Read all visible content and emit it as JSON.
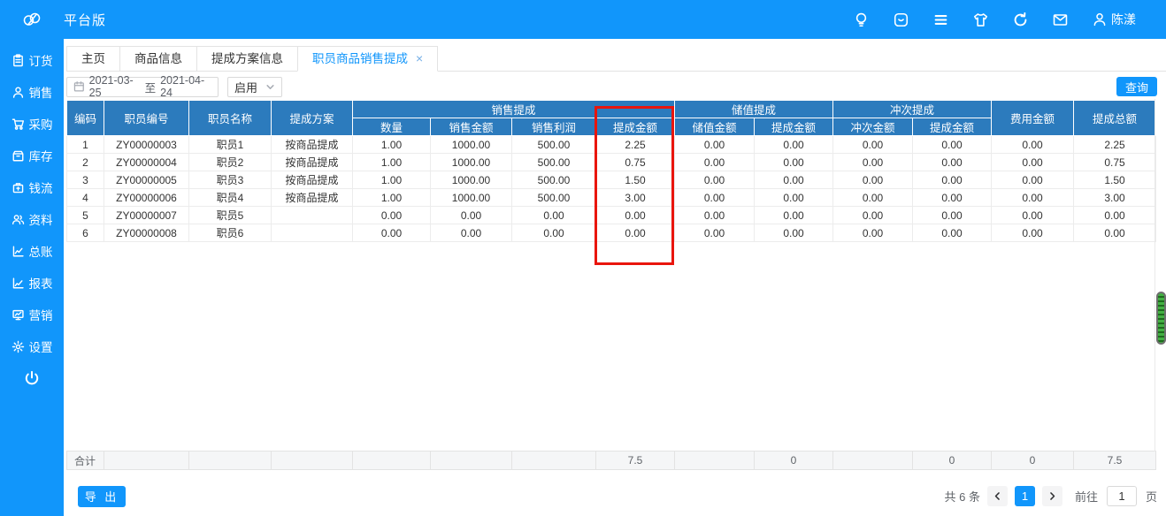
{
  "topbar": {
    "brand": "平台版",
    "user_name": "陈漾"
  },
  "sidebar": {
    "items": [
      {
        "icon": "order-icon",
        "label": "订货"
      },
      {
        "icon": "sales-icon",
        "label": "销售"
      },
      {
        "icon": "purchase-icon",
        "label": "采购"
      },
      {
        "icon": "inventory-icon",
        "label": "库存"
      },
      {
        "icon": "cashflow-icon",
        "label": "钱流"
      },
      {
        "icon": "data-icon",
        "label": "资料"
      },
      {
        "icon": "ledger-icon",
        "label": "总账"
      },
      {
        "icon": "report-icon",
        "label": "报表"
      },
      {
        "icon": "marketing-icon",
        "label": "营销"
      },
      {
        "icon": "settings-icon",
        "label": "设置"
      }
    ]
  },
  "tabs": [
    {
      "label": "主页"
    },
    {
      "label": "商品信息"
    },
    {
      "label": "提成方案信息"
    },
    {
      "label": "职员商品销售提成",
      "close": "×",
      "active": true
    }
  ],
  "filters": {
    "date_start": "2021-03-25",
    "date_separator": "至",
    "date_end": "2021-04-24",
    "status": "启用",
    "query_label": "查询"
  },
  "table": {
    "header": {
      "fixed_left": [
        "编码",
        "职员编号",
        "职员名称",
        "提成方案"
      ],
      "groups": [
        {
          "label": "销售提成",
          "children": [
            "数量",
            "销售金额",
            "销售利润",
            "提成金额"
          ]
        },
        {
          "label": "储值提成",
          "children": [
            "储值金额",
            "提成金额"
          ]
        },
        {
          "label": "冲次提成",
          "children": [
            "冲次金额",
            "提成金额"
          ]
        }
      ],
      "fixed_right": [
        "费用金额",
        "提成总额"
      ]
    },
    "rows": [
      [
        "1",
        "ZY00000003",
        "职员1",
        "按商品提成",
        "1.00",
        "1000.00",
        "500.00",
        "2.25",
        "0.00",
        "0.00",
        "0.00",
        "0.00",
        "0.00",
        "2.25"
      ],
      [
        "2",
        "ZY00000004",
        "职员2",
        "按商品提成",
        "1.00",
        "1000.00",
        "500.00",
        "0.75",
        "0.00",
        "0.00",
        "0.00",
        "0.00",
        "0.00",
        "0.75"
      ],
      [
        "3",
        "ZY00000005",
        "职员3",
        "按商品提成",
        "1.00",
        "1000.00",
        "500.00",
        "1.50",
        "0.00",
        "0.00",
        "0.00",
        "0.00",
        "0.00",
        "1.50"
      ],
      [
        "4",
        "ZY00000006",
        "职员4",
        "按商品提成",
        "1.00",
        "1000.00",
        "500.00",
        "3.00",
        "0.00",
        "0.00",
        "0.00",
        "0.00",
        "0.00",
        "3.00"
      ],
      [
        "5",
        "ZY00000007",
        "职员5",
        "",
        "0.00",
        "0.00",
        "0.00",
        "0.00",
        "0.00",
        "0.00",
        "0.00",
        "0.00",
        "0.00",
        "0.00"
      ],
      [
        "6",
        "ZY00000008",
        "职员6",
        "",
        "0.00",
        "0.00",
        "0.00",
        "0.00",
        "0.00",
        "0.00",
        "0.00",
        "0.00",
        "0.00",
        "0.00"
      ]
    ],
    "summary": [
      "合计",
      "",
      "",
      "",
      "",
      "",
      "",
      "7.5",
      "",
      "0",
      "",
      "0",
      "0",
      "7.5"
    ],
    "highlight": {
      "column": "提成金额",
      "group": "销售提成",
      "color": "#e9150d"
    }
  },
  "bottom": {
    "export_label": "导 出",
    "total_count": "共 6 条",
    "current_page": "1",
    "goto_label": "前往",
    "goto_value": "1",
    "goto_unit": "页"
  }
}
